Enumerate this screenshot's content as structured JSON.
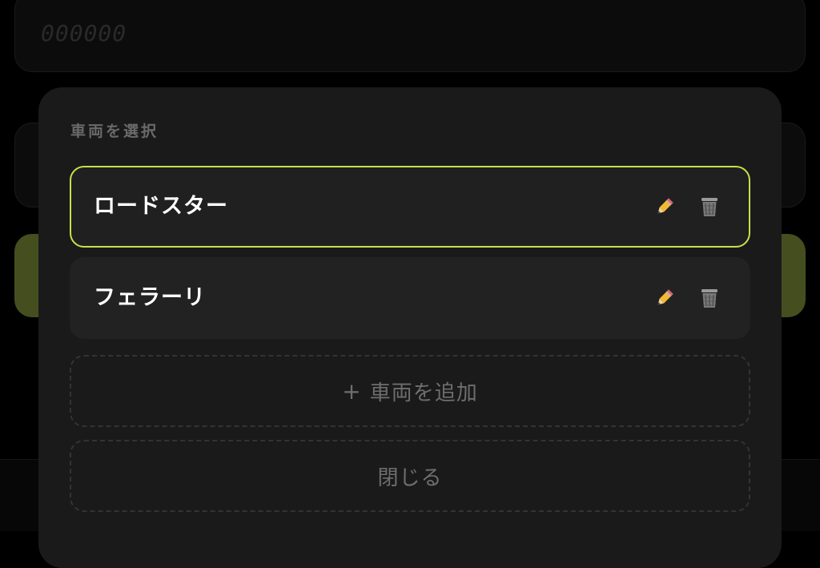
{
  "background": {
    "input_placeholder": "000000"
  },
  "sheet": {
    "title": "車両を選択",
    "vehicles": [
      {
        "name": "ロードスター",
        "selected": true
      },
      {
        "name": "フェラーリ",
        "selected": false
      }
    ],
    "add_button": {
      "icon": "+",
      "label": "車両を追加"
    },
    "close_button": {
      "label": "閉じる"
    }
  },
  "icons": {
    "edit": "pencil-icon",
    "delete": "trash-icon"
  },
  "colors": {
    "accent": "#c9e04a",
    "sheet_bg": "#1a1a1a",
    "row_bg": "#222222",
    "muted_text": "#6e6e6e"
  }
}
